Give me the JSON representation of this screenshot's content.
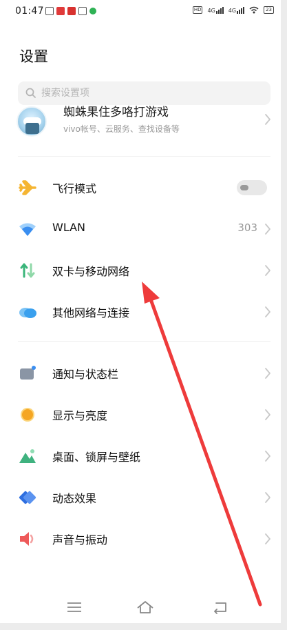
{
  "status_bar": {
    "time": "01:47",
    "hd_badge": "HD",
    "signal1": "4G",
    "signal2": "4G",
    "battery": "23"
  },
  "page": {
    "title": "设置"
  },
  "search": {
    "placeholder": "搜索设置项"
  },
  "account": {
    "name": "蜘蛛果住多咯打游戏",
    "subtitle": "vivo帐号、云服务、查找设备等"
  },
  "settings_group1": [
    {
      "label": "飞行模式",
      "icon": "airplane-icon",
      "control": "toggle",
      "toggle_on": false,
      "color": "#f5b533"
    },
    {
      "label": "WLAN",
      "icon": "wifi-icon",
      "value": "303",
      "color": "#3a8ef0"
    },
    {
      "label": "双卡与移动网络",
      "icon": "dual-sim-icon",
      "color": "#3ab57a"
    },
    {
      "label": "其他网络与连接",
      "icon": "cloud-icon",
      "color": "#3aa0ee"
    }
  ],
  "settings_group2": [
    {
      "label": "通知与状态栏",
      "icon": "notification-icon",
      "color": "#8a95a5"
    },
    {
      "label": "显示与亮度",
      "icon": "brightness-icon",
      "color": "#f5a623"
    },
    {
      "label": "桌面、锁屏与壁纸",
      "icon": "wallpaper-icon",
      "color": "#3fb27f"
    },
    {
      "label": "动态效果",
      "icon": "animation-icon",
      "color": "#2f6fe0"
    },
    {
      "label": "声音与振动",
      "icon": "sound-icon",
      "color": "#ee5a5a"
    }
  ],
  "nav": {
    "icons": [
      "menu-icon",
      "home-icon",
      "back-icon"
    ]
  },
  "annotation": {
    "color": "#ee3b3b",
    "icon": "red-arrow-annotation"
  }
}
